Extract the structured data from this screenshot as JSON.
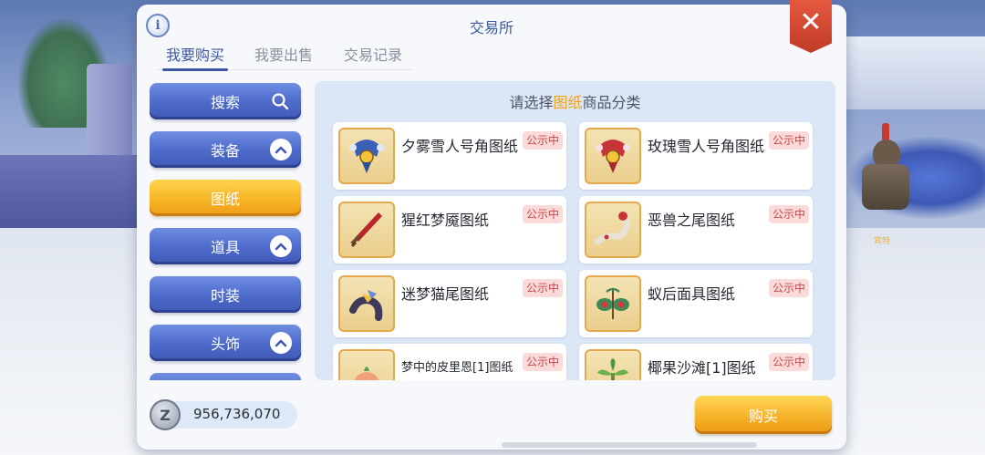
{
  "window": {
    "title": "交易所",
    "info_label": "i",
    "close_label": "✕"
  },
  "tabs": [
    {
      "label": "我要购买",
      "active": true
    },
    {
      "label": "我要出售",
      "active": false
    },
    {
      "label": "交易记录",
      "active": false
    }
  ],
  "menu": [
    {
      "label": "搜索",
      "icon": "search-icon"
    },
    {
      "label": "装备",
      "icon": "chevron-up-icon"
    },
    {
      "label": "图纸",
      "selected": true
    },
    {
      "label": "道具",
      "icon": "chevron-up-icon"
    },
    {
      "label": "时装"
    },
    {
      "label": "头饰",
      "icon": "chevron-up-icon"
    }
  ],
  "content": {
    "heading_prefix": "请选择",
    "heading_highlight": "图纸",
    "heading_suffix": "商品分类",
    "items": [
      {
        "name": "夕雾雪人号角图纸",
        "badge": "公示中",
        "icon": "horn-blueprint-icon"
      },
      {
        "name": "玫瑰雪人号角图纸",
        "badge": "公示中",
        "icon": "horn-blueprint-icon"
      },
      {
        "name": "猩红梦魇图纸",
        "badge": "公示中",
        "icon": "sword-blueprint-icon"
      },
      {
        "name": "恶兽之尾图纸",
        "badge": "公示中",
        "icon": "tail-blueprint-icon"
      },
      {
        "name": "迷梦猫尾图纸",
        "badge": "公示中",
        "icon": "cat-tail-blueprint-icon"
      },
      {
        "name": "蚁后面具图纸",
        "badge": "公示中",
        "icon": "mask-blueprint-icon"
      },
      {
        "name": "梦中的皮里恩[1]图纸",
        "badge": "公示中",
        "icon": "pet-blueprint-icon"
      },
      {
        "name": "椰果沙滩[1]图纸",
        "badge": "公示中",
        "icon": "plant-blueprint-icon"
      }
    ]
  },
  "footer": {
    "currency_symbol": "Z",
    "amount": "956,736,070",
    "buy_label": "购买"
  },
  "scene": {
    "npc_name": "宾特"
  },
  "colors": {
    "accent": "#3c58a4",
    "highlight": "#f0a21d",
    "badge_bg": "#fbdada",
    "badge_text": "#c74848"
  }
}
